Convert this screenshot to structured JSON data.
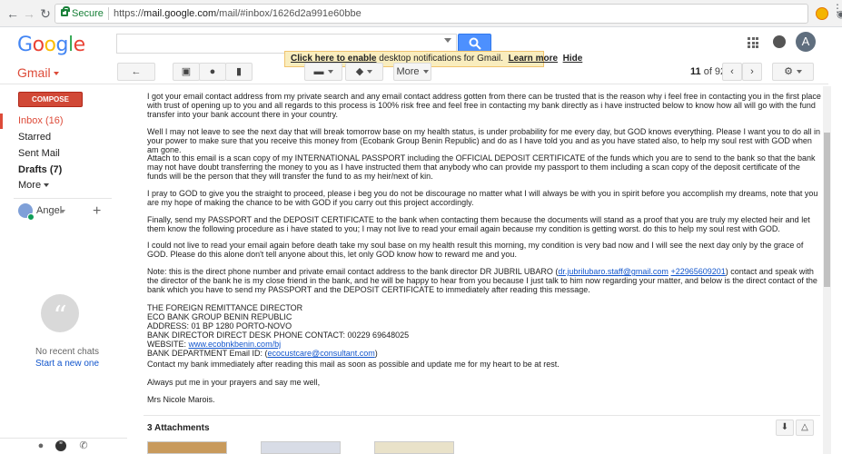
{
  "browser": {
    "secure_label": "Secure",
    "url_prefix": "https://",
    "url_main": "mail.google.com",
    "url_rest": "/mail/#inbox/1626d2a991e60bbe"
  },
  "header": {
    "logo_text": "Google",
    "avatar_letter": "A",
    "notification_text": " desktop notifications for Gmail.",
    "notification_link": "Click here to enable",
    "learn_more": "Learn more",
    "hide": "Hide"
  },
  "toolbar": {
    "app_label": "Gmail",
    "more_label": "More",
    "page_current": "11",
    "page_of": "of 92"
  },
  "sidebar": {
    "compose_label": "COMPOSE",
    "items": [
      {
        "label": "Inbox (16)"
      },
      {
        "label": "Starred"
      },
      {
        "label": "Sent Mail"
      },
      {
        "label": "Drafts (7)"
      },
      {
        "label": "More"
      }
    ],
    "user_name": "Angel",
    "no_chats": "No recent chats",
    "start_new": "Start a new one"
  },
  "message": {
    "p1": "I got your email contact address from my private search and any email contact address gotten from there can be trusted that is the reason why i feel free in contacting you in the first place with trust of opening up to you and all regards to this process is 100% risk free and feel free in contacting my bank directly as i have instructed below to know how all will go with the fund transfer into your bank account there in your country.",
    "p2": "Well I may not leave to see the next day that will break tomorrow base on my health status, is under probability for me every day, but GOD knows everything. Please I want you to do all in your power to make sure that you receive this money from (Ecobank Group Benin Republic) and do as I have told you and as you have stated also, to help my soul rest with GOD when am gone.",
    "p3": "Attach to this email is a scan copy of my INTERNATIONAL PASSPORT including the OFFICIAL DEPOSIT CERTIFICATE of the funds which you are to send to the bank so that the bank may not have doubt transferring the money to you as I have instructed them that anybody who can provide my passport to them including a scan copy of the deposit certificate of the funds will be the person that they will transfer the fund to as my heir/next of kin.",
    "p4": "I pray to GOD to give you the straight to proceed, please i beg you do not be discourage no matter what I will always be with you in spirit before you accomplish my dreams, note that you are my hope of making the chance to be with GOD if you carry out this project accordingly.",
    "p5": "Finally, send my PASSPORT and the DEPOSIT CERTIFICATE to the bank when contacting them because the documents will stand as a proof that you are truly my elected heir and let them know the following procedure as i have stated to you; I may not live to read your email again because my condition is getting worst. do this to help my soul rest with GOD.",
    "p6": "I could not live to read your email again before death take my soul base on my health result this morning, my condition is very bad now and I will see the next day only by the grace of GOD. Please do this alone don't tell anyone about this, let only GOD know how to reward me and you.",
    "p7_a": "Note: this is the direct phone number and private email contact address to the bank director DR JUBRIL UBARO (",
    "p7_email": "dr.jubrilubaro.staff@gmail.com",
    "p7_b": " ",
    "p7_phone": "+22965609201",
    "p7_c": ") contact and speak with the director of the bank he is my close friend in the bank, and he will be happy to hear from you because I just talk to him now regarding your matter, and below is the direct contact of the bank which you have to send my PASSPORT and the DEPOSIT CERTIFICATE to immediately after reading this message.",
    "contact_l1": "THE FOREIGN REMITTANCE DIRECTOR",
    "contact_l2": "ECO BANK GROUP BENIN REPUBLIC",
    "contact_l3": "ADDRESS: 01 BP 1280 PORTO-NOVO",
    "contact_l4": "BANK DIRECTOR DIRECT DESK PHONE CONTACT: 00229 69648025",
    "contact_l5_label": "WEBSITE: ",
    "contact_l5_link": "www.ecobnkbenin.com/bj",
    "contact_l6_label": "BANK DEPARTMENT Email ID:  (",
    "contact_l6_link": "ecocustcare@consultant.com",
    "contact_l6_end": ")",
    "p9": "Contact my bank immediately after reading this mail as soon as possible and update me for my heart to be at rest.",
    "p10": "Always put me in your prayers and say me well,",
    "p11": "Mrs Nicole Marois."
  },
  "attachments": {
    "title": "3 Attachments"
  }
}
